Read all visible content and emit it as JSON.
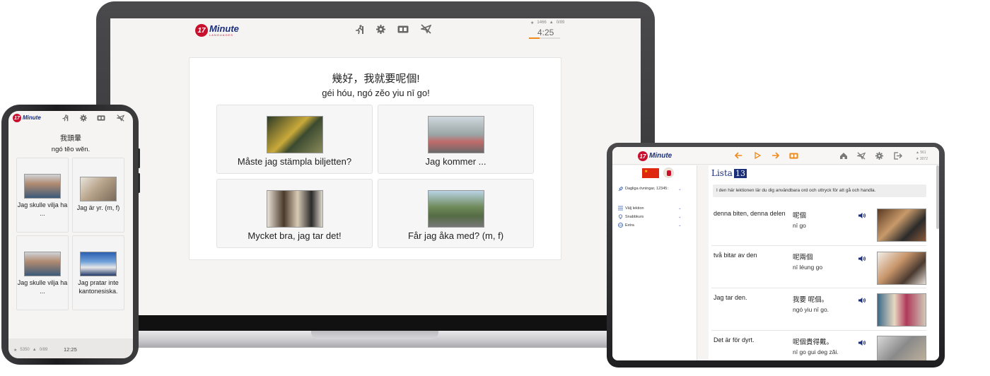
{
  "colors": {
    "brand_red": "#c8102e",
    "brand_blue": "#1b2f7a",
    "accent_orange": "#f08a1c",
    "lista_badge": "#1b2f7a"
  },
  "logo": {
    "number": "17",
    "name": "Minute",
    "tagline": "LANGUAGES"
  },
  "laptop": {
    "toolbar_icons": [
      "running-icon",
      "gear-icon",
      "flashcard-icon",
      "no-flight-icon"
    ],
    "stats": {
      "stars": "1466",
      "caps": "0/89"
    },
    "timer": "4:25",
    "progress": 0.35,
    "question_zh": "幾好，我就要呢個!",
    "question_rom": "géi hóu, ngó zĕo yiu nī go!",
    "answers": [
      {
        "label": "Måste jag stämpla biljetten?",
        "image": "ticket-machine-photo"
      },
      {
        "label": "Jag kommer ...",
        "image": "travelers-photo"
      },
      {
        "label": "Mycket bra, jag tar det!",
        "image": "handshake-photo"
      },
      {
        "label": "Får jag åka med? (m, f)",
        "image": "hitchhiker-photo"
      }
    ]
  },
  "phone": {
    "toolbar_icons": [
      "running-icon",
      "gear-icon",
      "flashcard-icon",
      "no-flight-icon"
    ],
    "question_zh": "我頭暈",
    "question_rom": "ngó tĕo wĕn.",
    "answers": [
      {
        "label": "Jag skulle vilja ha ...",
        "image": "woman-smiling-photo"
      },
      {
        "label": "Jag är yr. (m, f)",
        "image": "dizzy-woman-photo"
      },
      {
        "label": "Jag skulle vilja ha ...",
        "image": "woman-smiling-photo"
      },
      {
        "label": "Jag pratar inte kantonesiska.",
        "image": "businessman-photo"
      }
    ],
    "stats": {
      "stars": "5350",
      "caps": "0/89"
    },
    "timer": "12:25"
  },
  "tablet": {
    "nav_icons": [
      "arrow-left-icon",
      "play-icon",
      "arrow-right-icon",
      "flashcard-icon"
    ],
    "right_icons": [
      "home-icon",
      "no-flight-icon",
      "gear-icon",
      "logout-icon"
    ],
    "stats": {
      "caps": "561",
      "stars": "3072"
    },
    "sidebar": {
      "items": [
        {
          "label": "Dagliga övningar, 12345:",
          "icon": "rocket-icon"
        },
        {
          "label": "Välj lektion",
          "icon": "list-icon"
        },
        {
          "label": "Snabbkurs",
          "icon": "bulb-icon"
        },
        {
          "label": "Extra",
          "icon": "globe-icon"
        }
      ]
    },
    "lista_title": "Lista",
    "lista_number": "13",
    "intro": "I den här lektionen lär du dig användbara ord och uttryck för att gå och handla.",
    "rows": [
      {
        "sv": "denna biten, denna delen",
        "zh": "呢個",
        "rom": "nī go",
        "image": "baker-photo"
      },
      {
        "sv": "två bitar av den",
        "zh": "呢兩個",
        "rom": "nī léung go",
        "image": "woman-peace-photo"
      },
      {
        "sv": "Jag tar den.",
        "zh": "我要 呢個。",
        "rom": "ngó yiu nī go.",
        "image": "shopping-women-photo"
      },
      {
        "sv": "Det är för dyrt.",
        "zh": "呢個貴得戴。",
        "rom": "nī go gui deg zăi.",
        "image": "shop-photo"
      }
    ]
  }
}
